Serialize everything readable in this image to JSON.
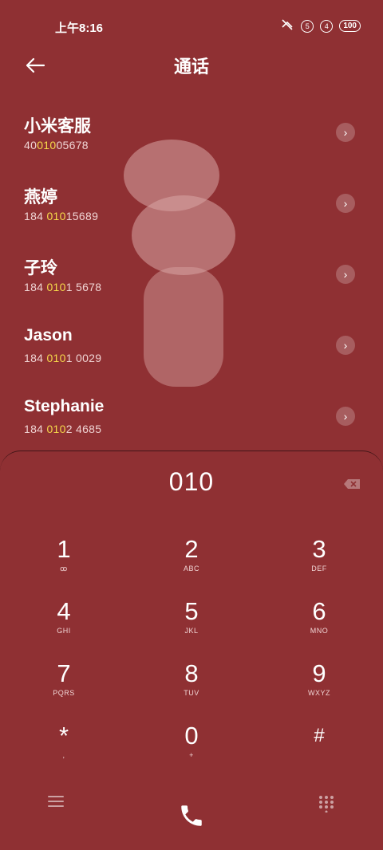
{
  "status_bar": {
    "time": "上午8:16",
    "sim1": "5",
    "sim2": "4",
    "battery": "100"
  },
  "header": {
    "title": "通话",
    "back_icon": "arrow-left-icon"
  },
  "contacts": [
    {
      "name": "小米客服",
      "num_pre": "40",
      "num_hl": "010",
      "num_post": "05678"
    },
    {
      "name": "燕婷",
      "num_pre": "184 ",
      "num_hl": "010",
      "num_post": "15689"
    },
    {
      "name": "子玲",
      "num_pre": "184 ",
      "num_hl": "010",
      "num_post": "1 5678"
    },
    {
      "name": "Jason",
      "num_pre": "184 ",
      "num_hl": "010",
      "num_post": "1 0029"
    },
    {
      "name": "Stephanie",
      "num_pre": "184 ",
      "num_hl": "010",
      "num_post": "2 4685"
    }
  ],
  "dialer": {
    "display": "010",
    "keys": [
      {
        "digit": "1",
        "letters": "ꝏ"
      },
      {
        "digit": "2",
        "letters": "ABC"
      },
      {
        "digit": "3",
        "letters": "DEF"
      },
      {
        "digit": "4",
        "letters": "GHI"
      },
      {
        "digit": "5",
        "letters": "JKL"
      },
      {
        "digit": "6",
        "letters": "MNO"
      },
      {
        "digit": "7",
        "letters": "PQRS"
      },
      {
        "digit": "8",
        "letters": "TUV"
      },
      {
        "digit": "9",
        "letters": "WXYZ"
      },
      {
        "digit": "*",
        "letters": ","
      },
      {
        "digit": "0",
        "letters": "+"
      },
      {
        "digit": "#",
        "letters": ""
      }
    ]
  },
  "bottom_bar": {
    "menu_icon": "menu-icon",
    "call_icon": "phone-icon",
    "dialpad_icon": "dialpad-icon"
  },
  "colors": {
    "background": "#8f3033",
    "highlight": "#f6d94a"
  }
}
